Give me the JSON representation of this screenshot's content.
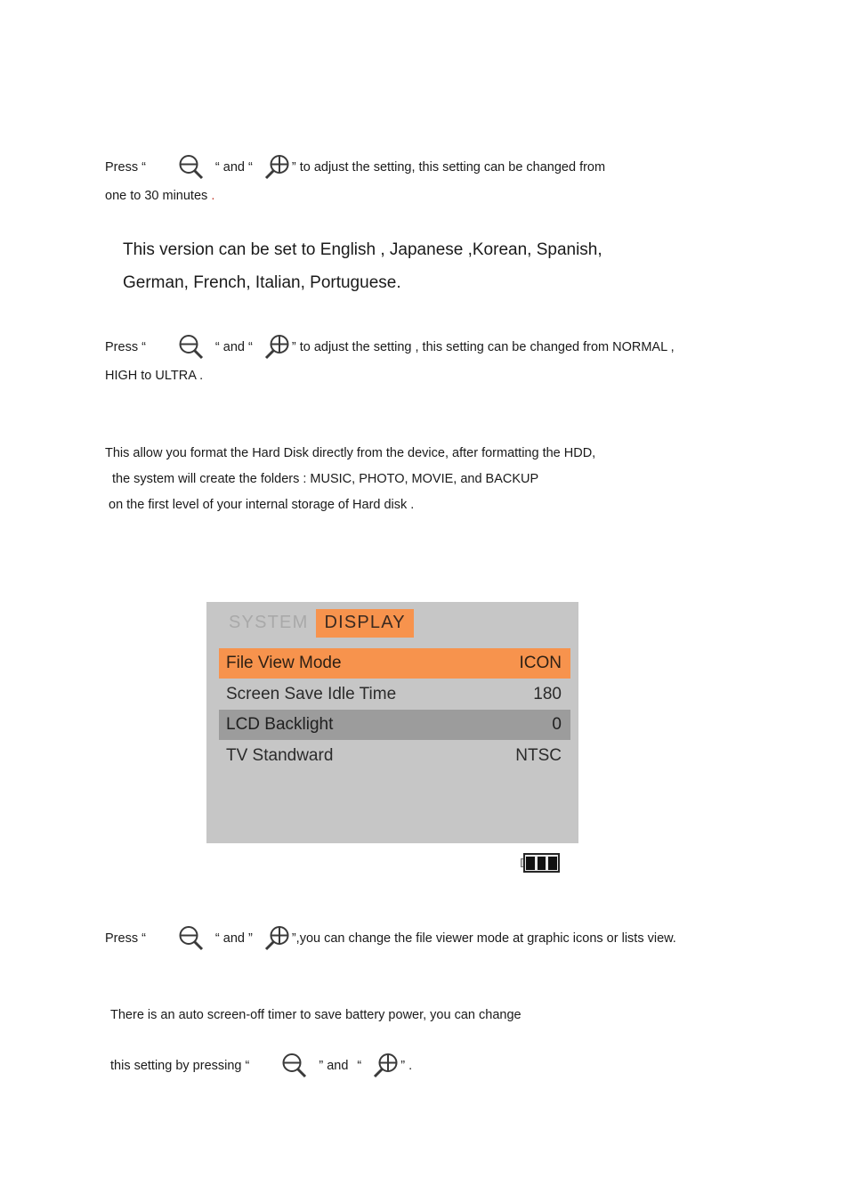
{
  "document": {
    "background": "#ffffff",
    "accent_orange": "#f7934d",
    "highlight_grey": "#9c9c9c",
    "panel_grey": "#c6c6c6"
  },
  "icons": {
    "zoom_out": "magnifier-minus-icon",
    "zoom_in": "magnifier-plus-icon",
    "battery": "battery-icon"
  },
  "blocks": {
    "para1": {
      "lead": "Press “",
      "mid": "“ and “",
      "tail": "” to adjust the setting, this setting can be changed from",
      "line2": "one to 30 minutes",
      "line2_dot": "."
    },
    "para2": {
      "line1": "This version can be set to English , Japanese ,Korean, Spanish,",
      "line2": "German, French, Italian, Portuguese."
    },
    "para3": {
      "lead": "Press “",
      "mid": "“ and “",
      "tail": "” to adjust the setting , this setting can be changed from NORMAL ,",
      "line2": "HIGH to ULTRA ."
    },
    "para4": {
      "line1": "This allow you format the Hard Disk directly from the device, after formatting the HDD,",
      "line2": "the system will create the folders : MUSIC, PHOTO, MOVIE, and BACKUP",
      "line3": "on the first level of your internal storage of Hard disk ."
    },
    "para5": {
      "lead": "Press “",
      "mid": "“ and ”",
      "tail": "”,you can change the file viewer mode at graphic icons or lists view."
    },
    "para6": {
      "line1": "There is an auto screen-off timer to save battery power, you can change",
      "lead": "this setting by pressing “",
      "mid": "” and",
      "quote": "“",
      "tail": "” ."
    }
  },
  "device_screen": {
    "tabs": [
      {
        "label": "SYSTEM",
        "active": false
      },
      {
        "label": "DISPLAY",
        "active": true
      }
    ],
    "rows": [
      {
        "label": "File View Mode",
        "value": "ICON",
        "state": "orange"
      },
      {
        "label": "Screen Save Idle Time",
        "value": "180",
        "state": "plain"
      },
      {
        "label": "LCD Backlight",
        "value": "0",
        "state": "grey"
      },
      {
        "label": "TV Standward",
        "value": "NTSC",
        "state": "plain"
      }
    ],
    "battery": {
      "cells": 3
    }
  }
}
